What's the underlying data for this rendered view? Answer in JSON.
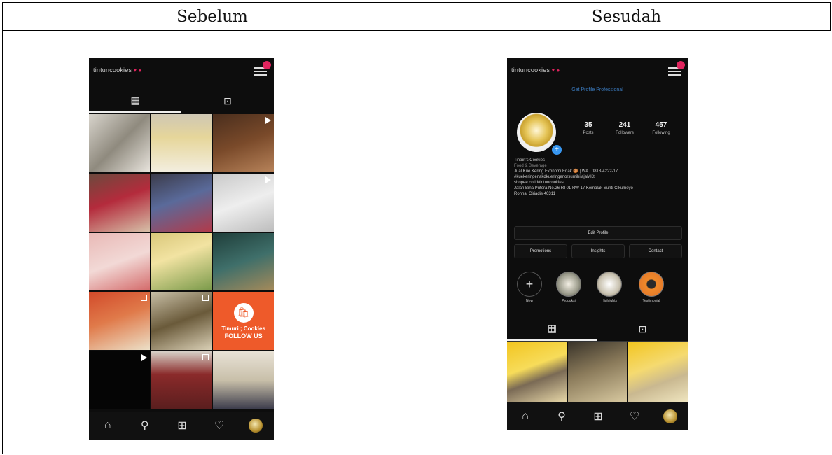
{
  "table": {
    "headers": [
      "Sebelum",
      "Sesudah"
    ]
  },
  "before": {
    "username": "tintuncookies",
    "tiles": [
      {
        "bg": "linear-gradient(135deg,#d8d4cc,#8f8a7e 50%,#e8e4dd)",
        "badge": ""
      },
      {
        "bg": "linear-gradient(180deg,#cfc7b4,#e6d69a 40%,#f3eee0)",
        "badge": ""
      },
      {
        "bg": "linear-gradient(160deg,#4a2e1d,#7a4a2a 50%,#b7835a)",
        "badge": "play"
      },
      {
        "bg": "linear-gradient(160deg,#6b4a3d,#b42b3c 45%,#d6c0a8)",
        "badge": ""
      },
      {
        "bg": "linear-gradient(160deg,#3b3b4a,#5a6a9a 45%,#b23a4a)",
        "badge": ""
      },
      {
        "bg": "linear-gradient(160deg,#c9c9c9,#eeeeee 50%,#bdbdbd)",
        "badge": "play"
      },
      {
        "bg": "linear-gradient(160deg,#e9b9b6,#f2d9d6 50%,#d46a6a)",
        "badge": ""
      },
      {
        "bg": "linear-gradient(160deg,#d9c77a,#f2e3a2 40%,#7a9a4a)",
        "badge": ""
      },
      {
        "bg": "linear-gradient(160deg,#1f3e3a,#3f6f6a 50%,#a58a5a)",
        "badge": ""
      },
      {
        "bg": "linear-gradient(160deg,#d24a2a,#e07a4a 45%,#ece0c8)",
        "badge": "multi"
      },
      {
        "bg": "linear-gradient(160deg,#c8bfa6,#6a5a3a 50%,#d9cfb5)",
        "badge": "multi"
      },
      {
        "bg": "#ee5a2a",
        "badge": "",
        "promo": true
      },
      {
        "bg": "#050505",
        "badge": "play"
      },
      {
        "bg": "linear-gradient(180deg,#d7d2c8,#8a2a2a 40%,#5a1e1e)",
        "badge": "multi"
      },
      {
        "bg": "linear-gradient(180deg,#e8e2d6,#c8bfa9 50%,#3a3a4a)",
        "badge": ""
      }
    ],
    "promo_text": [
      "Timuri ; Cookies",
      "FOLLOW US"
    ]
  },
  "after": {
    "username": "tintuncookies",
    "promote_link": "Get Profile Professional",
    "stats": [
      {
        "n": "35",
        "l": "Posts"
      },
      {
        "n": "241",
        "l": "Followers"
      },
      {
        "n": "457",
        "l": "Following"
      }
    ],
    "bio": {
      "name": "Tintun's Cookies",
      "category": "Food & Beverage",
      "lines": [
        "Jual Kue Kering Ekonomi Enak 🍪 | WA : 0818-4222-17",
        "#kuekeringenakdkueringenorsumihilajaMKt",
        "shopee.co.id/tintuncookies",
        "Jalan Bina Putera No.26 RT01 RW 17 Kemalak Sunti Cikumoyo",
        "Ronna, Ciriadis 46311"
      ]
    },
    "edit_profile": "Edit Profile",
    "actions": [
      "Promotions",
      "Insights",
      "Contact"
    ],
    "highlights": [
      {
        "t": "New",
        "bg": "#0d0d0d",
        "plus": true
      },
      {
        "t": "Produksi",
        "bg": "radial-gradient(circle,#f3efe4,#9a9a8a 60%,#3a3a34)"
      },
      {
        "t": "Highlights",
        "bg": "radial-gradient(circle,#ffffff,#c9c2b0 60%,#6a6255)"
      },
      {
        "t": "Testimonial",
        "bg": "radial-gradient(circle,#2a2a2a 0 25%,#f08a2a 30%,#e0722a 100%)"
      }
    ],
    "tiles": [
      {
        "bg": "linear-gradient(160deg,#f2c520,#f7dc5a 40%,#7a6a55 60%,#e8d8a8)"
      },
      {
        "bg": "linear-gradient(160deg,#3a342a,#8a7a5a 45%,#d8c9a0)"
      },
      {
        "bg": "linear-gradient(160deg,#f2c520,#f5da70 40%,#c9b890 65%,#f0e6c0)"
      }
    ]
  },
  "nav_icons": [
    "home-icon",
    "search-icon",
    "add-icon",
    "heart-icon",
    "avatar"
  ]
}
